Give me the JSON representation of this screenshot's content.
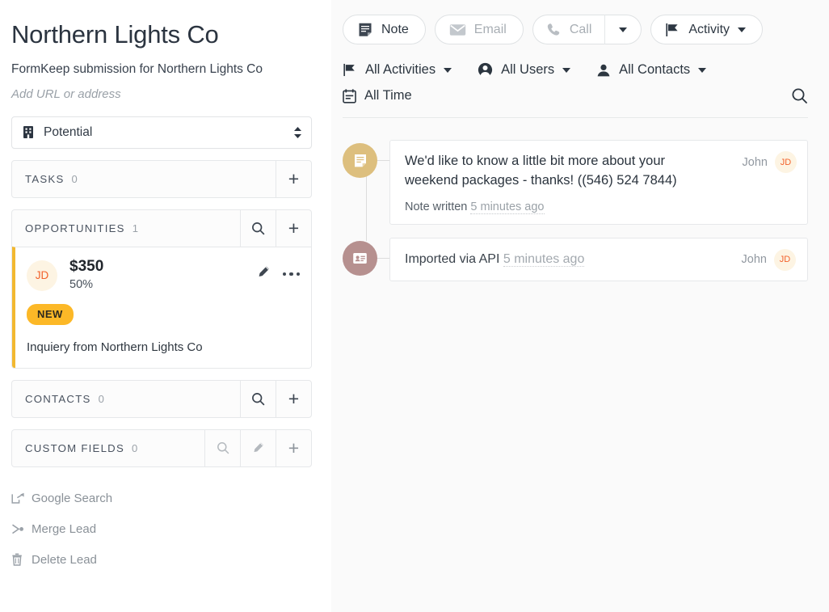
{
  "lead": {
    "title": "Northern Lights Co",
    "subtitle": "FormKeep submission for Northern Lights Co",
    "url_placeholder": "Add URL or address",
    "status": "Potential"
  },
  "sections": {
    "tasks": {
      "label": "TASKS",
      "count": "0"
    },
    "opportunities": {
      "label": "OPPORTUNITIES",
      "count": "1"
    },
    "contacts": {
      "label": "CONTACTS",
      "count": "0"
    },
    "custom_fields": {
      "label": "CUSTOM FIELDS",
      "count": "0"
    }
  },
  "opportunity": {
    "initials": "JD",
    "amount": "$350",
    "percent": "50%",
    "badge": "NEW",
    "description": "Inquiery from Northern Lights Co"
  },
  "lead_actions": [
    {
      "label": "Google Search",
      "icon": "external-link-icon"
    },
    {
      "label": "Merge Lead",
      "icon": "merge-icon"
    },
    {
      "label": "Delete Lead",
      "icon": "trash-icon"
    }
  ],
  "toolbar": {
    "note": "Note",
    "email": "Email",
    "call": "Call",
    "activity": "Activity"
  },
  "filters": {
    "activities": "All Activities",
    "users": "All Users",
    "contacts": "All Contacts",
    "time": "All Time"
  },
  "timeline": [
    {
      "kind": "note",
      "body": "We'd like to know a little bit more about your weekend packages - thanks! ((546) 524 7844)",
      "meta_label": "Note written",
      "meta_ago": "5 minutes ago",
      "author": "John",
      "author_initials": "JD",
      "badge_color": "#ddbf7e"
    },
    {
      "kind": "import",
      "body": "Imported via API",
      "meta_ago": "5 minutes ago",
      "author": "John",
      "author_initials": "JD",
      "badge_color": "#b6908f"
    }
  ],
  "colors": {
    "accent_amber": "#f2b830",
    "badge_new_bg": "#fcb827",
    "avatar_bg": "#fdf4e3",
    "avatar_fg": "#f2622b",
    "note_icon_bg": "#ddbf7e",
    "import_icon_bg": "#b6908f",
    "main_bg": "#fafafa"
  }
}
